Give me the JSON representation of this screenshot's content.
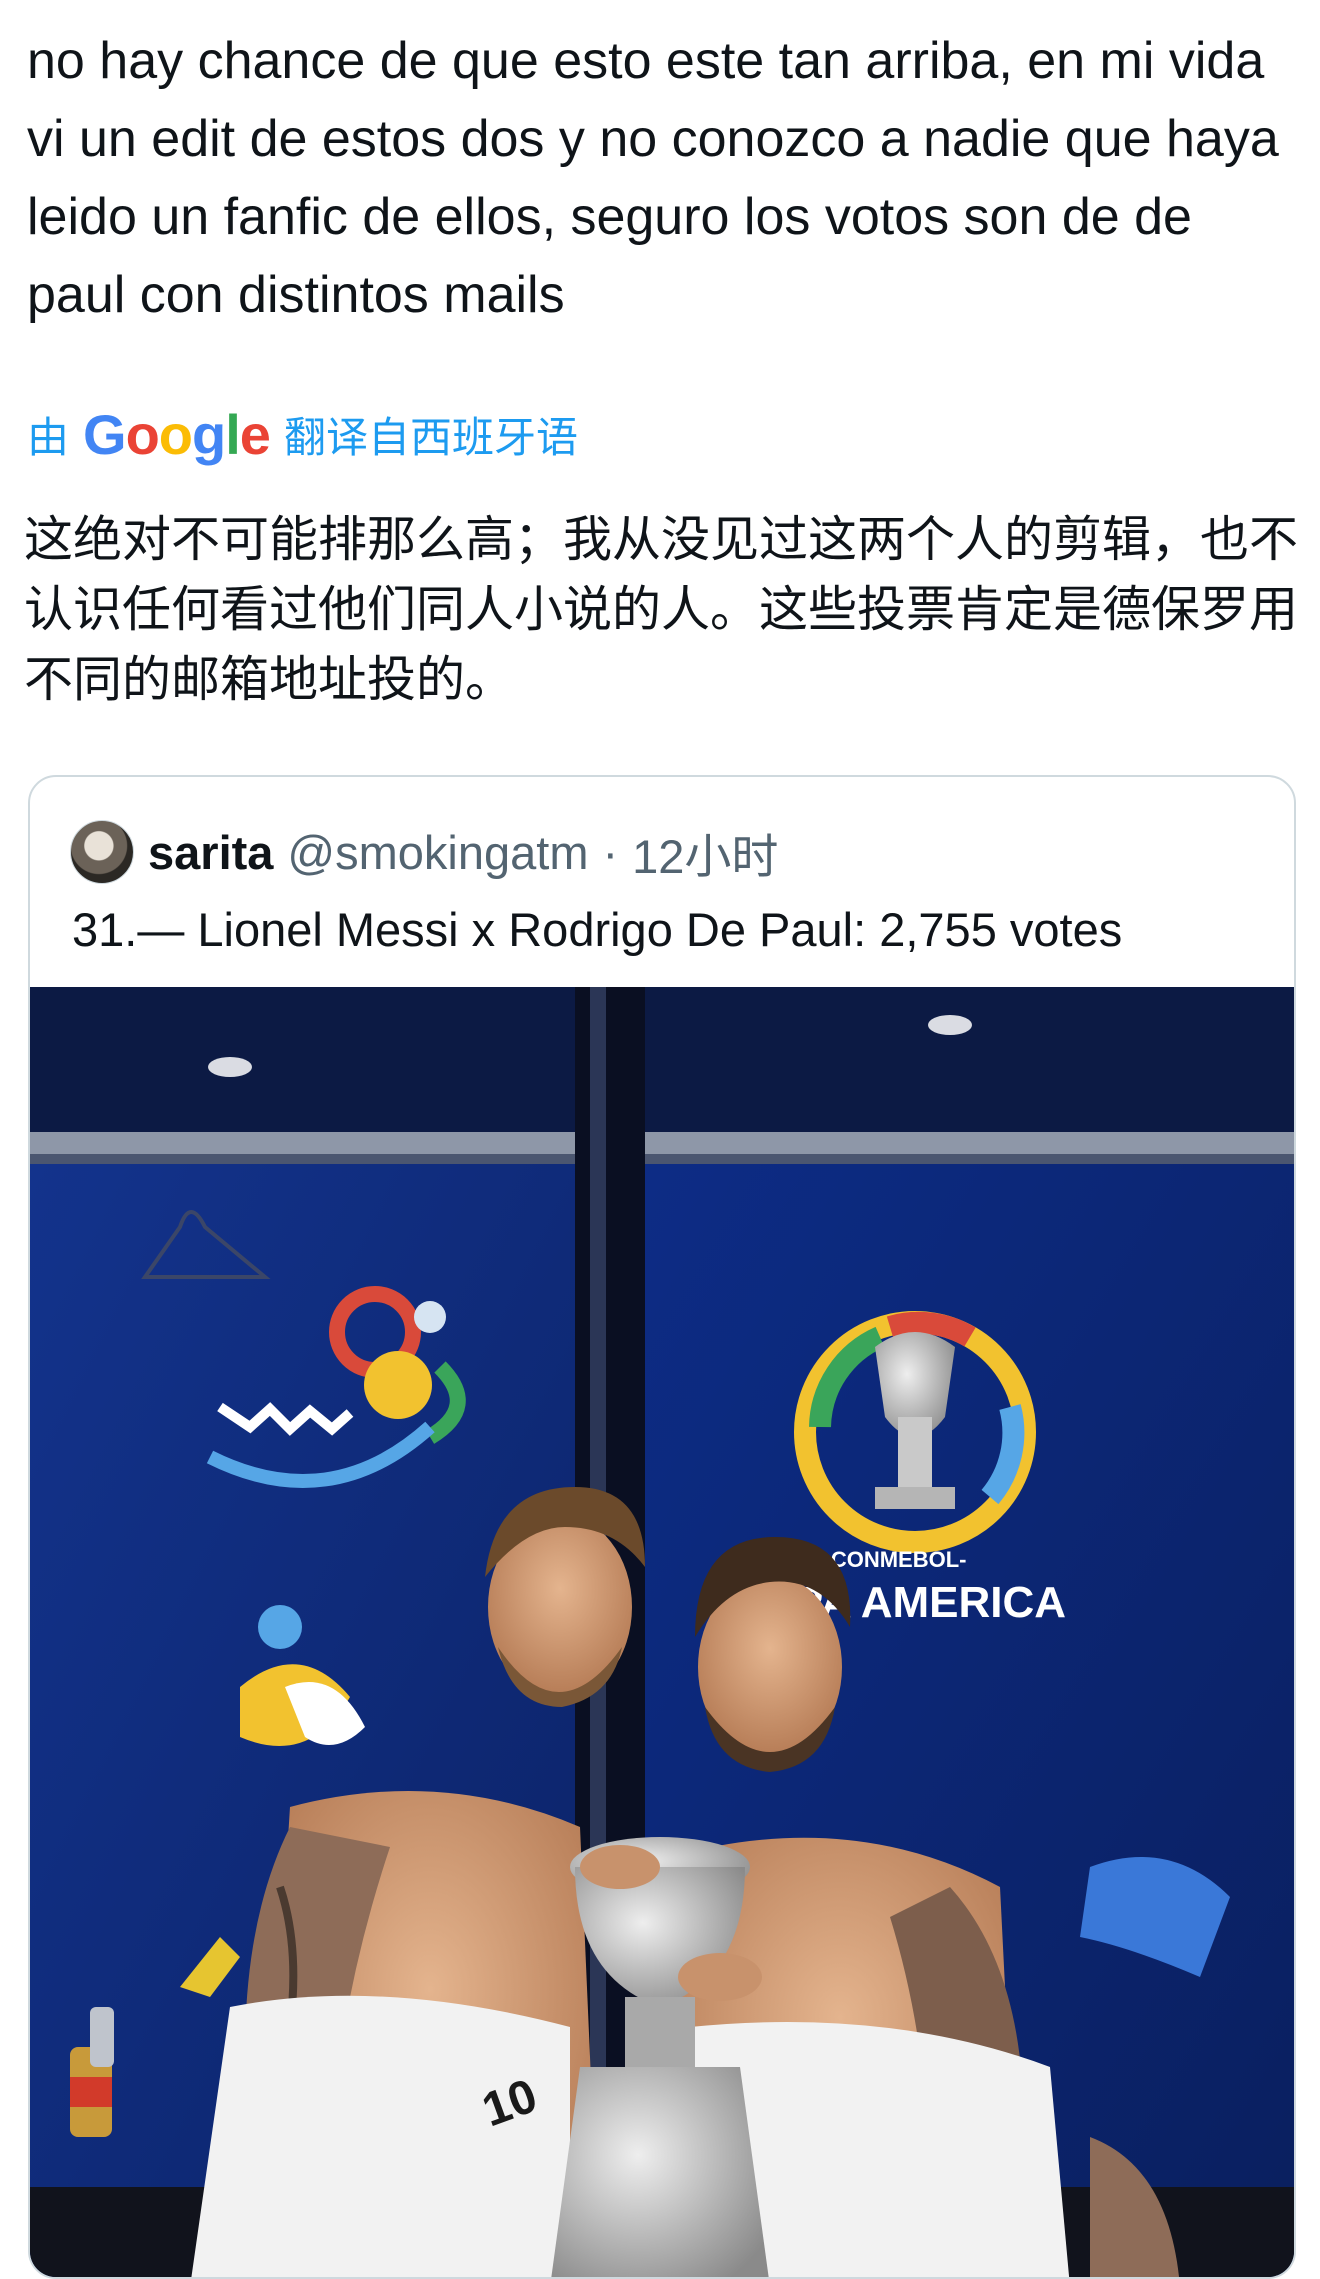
{
  "tweet": {
    "text": "no hay chance de que esto este tan arriba, en mi vida vi un edit de estos dos y no conozco a nadie que haya leido un fanfic de ellos, seguro los votos son de de paul con distintos mails",
    "translate_prefix": "由",
    "translate_suffix": "翻译自西班牙语",
    "translated_text": "这绝对不可能排那么高；我从没见过这两个人的剪辑，也不认识任何看过他们同人小说的人。这些投票肯定是德保罗用不同的邮箱地址投的。"
  },
  "google_logo": {
    "letters": [
      "G",
      "o",
      "o",
      "g",
      "l",
      "e"
    ]
  },
  "quoted": {
    "author_name": "sarita",
    "author_handle": "@smokingatm",
    "separator": "·",
    "time": "12小时",
    "text": "31.— Lionel Messi x Rodrigo De Paul: 2,755 votes",
    "photo": {
      "logo_small": "-CONMEBOL-",
      "logo_large": "PA AMERICA",
      "jersey_number": "10"
    }
  },
  "colors": {
    "text": "#0f1419",
    "secondary": "#536471",
    "link": "#1d9bf0",
    "border": "#cfd9de",
    "locker_blue": "#0a2a7a"
  }
}
